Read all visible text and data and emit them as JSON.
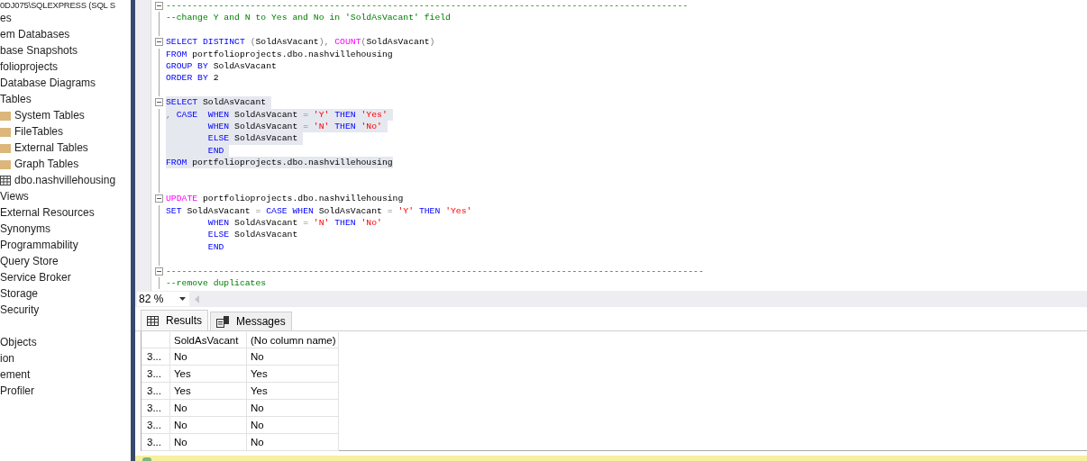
{
  "object_explorer": {
    "tree": [
      {
        "label": "0DJ075\\SQLEXPRESS (SQL S",
        "children": [
          {
            "label": "es",
            "children": [
              {
                "label": "em Databases"
              },
              {
                "label": "base Snapshots"
              },
              {
                "label": "folioprojects",
                "children": [
                  {
                    "label": "Database Diagrams"
                  },
                  {
                    "label": "Tables",
                    "children": [
                      {
                        "label": "System Tables",
                        "kind": "folder"
                      },
                      {
                        "label": "FileTables",
                        "kind": "folder"
                      },
                      {
                        "label": "External Tables",
                        "kind": "folder"
                      },
                      {
                        "label": "Graph Tables",
                        "kind": "folder"
                      },
                      {
                        "label": "dbo.nashvillehousing",
                        "kind": "table"
                      }
                    ]
                  },
                  {
                    "label": "Views"
                  },
                  {
                    "label": "External Resources"
                  },
                  {
                    "label": "Synonyms"
                  },
                  {
                    "label": "Programmability"
                  },
                  {
                    "label": "Query Store"
                  },
                  {
                    "label": "Service Broker"
                  },
                  {
                    "label": "Storage"
                  },
                  {
                    "label": "Security"
                  }
                ]
              }
            ]
          },
          {
            "label": "Objects"
          },
          {
            "label": "ion"
          },
          {
            "label": "ement"
          },
          {
            "label": "Profiler"
          }
        ]
      }
    ]
  },
  "editor": {
    "lines": [
      {
        "selected": false,
        "fold": true,
        "tokens": [
          {
            "kind": "comment",
            "text": "---------------------------------------------------------------------------------------------------"
          }
        ]
      },
      {
        "selected": false,
        "fold": false,
        "tokens": [
          {
            "kind": "comment",
            "text": "--change Y and N to Yes and No in 'SoldAsVacant' field"
          }
        ]
      },
      {
        "fold": false
      },
      {
        "selected": false,
        "fold": true,
        "tokens": [
          {
            "kind": "keyword",
            "text": "SELECT DISTINCT "
          },
          {
            "kind": "operator",
            "text": "("
          },
          {
            "kind": "plain",
            "text": "SoldAsVacant"
          },
          {
            "kind": "operator",
            "text": "), "
          },
          {
            "kind": "function",
            "text": "COUNT"
          },
          {
            "kind": "operator",
            "text": "("
          },
          {
            "kind": "plain",
            "text": "SoldAsVacant"
          },
          {
            "kind": "operator",
            "text": ")"
          }
        ]
      },
      {
        "selected": false,
        "fold": false,
        "tokens": [
          {
            "kind": "keyword",
            "text": "FROM"
          },
          {
            "kind": "plain",
            "text": " portfolioprojects.dbo.nashvillehousing"
          }
        ]
      },
      {
        "selected": false,
        "fold": false,
        "tokens": [
          {
            "kind": "keyword",
            "text": "GROUP BY"
          },
          {
            "kind": "plain",
            "text": " SoldAsVacant"
          }
        ]
      },
      {
        "selected": false,
        "fold": false,
        "tokens": [
          {
            "kind": "keyword",
            "text": "ORDER BY"
          },
          {
            "kind": "plain",
            "text": " 2"
          }
        ]
      },
      {
        "fold": false
      },
      {
        "selected": true,
        "fold": true,
        "tokens": [
          {
            "kind": "keyword",
            "text": "SELECT"
          },
          {
            "kind": "plain",
            "text": " SoldAsVacant "
          }
        ]
      },
      {
        "selected": true,
        "fold": false,
        "tokens": [
          {
            "kind": "operator",
            "text": ", "
          },
          {
            "kind": "keyword",
            "text": "CASE  WHEN"
          },
          {
            "kind": "plain",
            "text": " SoldAsVacant "
          },
          {
            "kind": "operator",
            "text": "= "
          },
          {
            "kind": "string",
            "text": "'Y' "
          },
          {
            "kind": "keyword",
            "text": "THEN "
          },
          {
            "kind": "string",
            "text": "'Yes' "
          }
        ]
      },
      {
        "selected": true,
        "fold": false,
        "tokens": [
          {
            "kind": "keyword",
            "text": "        WHEN"
          },
          {
            "kind": "plain",
            "text": " SoldAsVacant "
          },
          {
            "kind": "operator",
            "text": "= "
          },
          {
            "kind": "string",
            "text": "'N' "
          },
          {
            "kind": "keyword",
            "text": "THEN "
          },
          {
            "kind": "string",
            "text": "'No' "
          }
        ]
      },
      {
        "selected": true,
        "fold": false,
        "tokens": [
          {
            "kind": "keyword",
            "text": "        ELSE"
          },
          {
            "kind": "plain",
            "text": " SoldAsVacant "
          }
        ]
      },
      {
        "selected": true,
        "fold": false,
        "tokens": [
          {
            "kind": "keyword",
            "text": "        END "
          }
        ]
      },
      {
        "selected": true,
        "fold": false,
        "tokens": [
          {
            "kind": "keyword",
            "text": "FROM"
          },
          {
            "kind": "plain",
            "text": " portfolioprojects.dbo.nashvillehousing"
          }
        ]
      },
      {
        "fold": false
      },
      {
        "fold": false
      },
      {
        "selected": false,
        "fold": true,
        "tokens": [
          {
            "kind": "function",
            "text": "UPDATE"
          },
          {
            "kind": "plain",
            "text": " portfolioprojects.dbo.nashvillehousing"
          }
        ]
      },
      {
        "selected": false,
        "fold": false,
        "tokens": [
          {
            "kind": "keyword",
            "text": "SET"
          },
          {
            "kind": "plain",
            "text": " SoldAsVacant "
          },
          {
            "kind": "operator",
            "text": "= "
          },
          {
            "kind": "keyword",
            "text": "CASE WHEN"
          },
          {
            "kind": "plain",
            "text": " SoldAsVacant "
          },
          {
            "kind": "operator",
            "text": "= "
          },
          {
            "kind": "string",
            "text": "'Y' "
          },
          {
            "kind": "keyword",
            "text": "THEN "
          },
          {
            "kind": "string",
            "text": "'Yes'"
          }
        ]
      },
      {
        "selected": false,
        "fold": false,
        "tokens": [
          {
            "kind": "keyword",
            "text": "        WHEN"
          },
          {
            "kind": "plain",
            "text": " SoldAsVacant "
          },
          {
            "kind": "operator",
            "text": "= "
          },
          {
            "kind": "string",
            "text": "'N' "
          },
          {
            "kind": "keyword",
            "text": "THEN "
          },
          {
            "kind": "string",
            "text": "'No'"
          }
        ]
      },
      {
        "selected": false,
        "fold": false,
        "tokens": [
          {
            "kind": "keyword",
            "text": "        ELSE"
          },
          {
            "kind": "plain",
            "text": " SoldAsVacant"
          }
        ]
      },
      {
        "selected": false,
        "fold": false,
        "tokens": [
          {
            "kind": "keyword",
            "text": "        END"
          }
        ]
      },
      {
        "fold": false
      },
      {
        "selected": false,
        "fold": true,
        "tokens": [
          {
            "kind": "comment",
            "text": "------------------------------------------------------------------------------------------------------"
          }
        ]
      },
      {
        "selected": false,
        "fold": false,
        "tokens": [
          {
            "kind": "comment",
            "text": "--remove duplicates"
          }
        ]
      }
    ]
  },
  "zoom": {
    "value": "82 %"
  },
  "result_tabs": [
    {
      "label": "Results",
      "selected": true,
      "kind": "grid"
    },
    {
      "label": "Messages",
      "selected": false,
      "kind": "messages"
    }
  ],
  "results_grid": {
    "columns": [
      "SoldAsVacant",
      "(No column name)"
    ],
    "rows": [
      {
        "row_header": "3...",
        "cells": [
          "No",
          "No"
        ]
      },
      {
        "row_header": "3...",
        "cells": [
          "Yes",
          "Yes"
        ]
      },
      {
        "row_header": "3...",
        "cells": [
          "Yes",
          "Yes"
        ]
      },
      {
        "row_header": "3...",
        "cells": [
          "No",
          "No"
        ]
      },
      {
        "row_header": "3...",
        "cells": [
          "No",
          "No"
        ]
      },
      {
        "row_header": "3...",
        "cells": [
          "No",
          "No"
        ]
      }
    ]
  }
}
